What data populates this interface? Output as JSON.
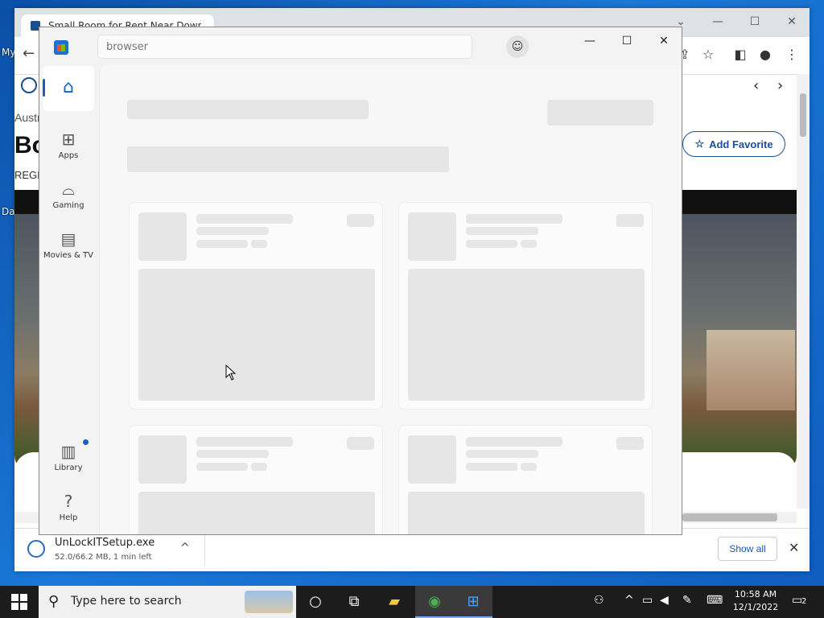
{
  "desktop": {
    "labels": [
      "My",
      "Da"
    ]
  },
  "chrome": {
    "tab_title": "Small Room for Rent Near Down...",
    "page_text": {
      "aus": "Austr",
      "heading": "Bo",
      "region": "REGI"
    },
    "add_favorite": "Add Favorite"
  },
  "downloads": {
    "file_name": "UnLockITSetup.exe",
    "progress": "52.0/66.2 MB, 1 min left",
    "show_all": "Show all"
  },
  "store": {
    "search_placeholder": "browser",
    "nav": [
      {
        "label": "Apps"
      },
      {
        "label": "Gaming"
      },
      {
        "label": "Movies & TV"
      },
      {
        "label": "Library"
      },
      {
        "label": "Help"
      }
    ]
  },
  "taskbar": {
    "search_placeholder": "Type here to search",
    "time": "10:58 AM",
    "date": "12/1/2022",
    "notification_count": "2"
  },
  "colors": {
    "accent": "#1560c0",
    "taskbar": "#1c1c1c",
    "skeleton": "#e6e6e6"
  }
}
